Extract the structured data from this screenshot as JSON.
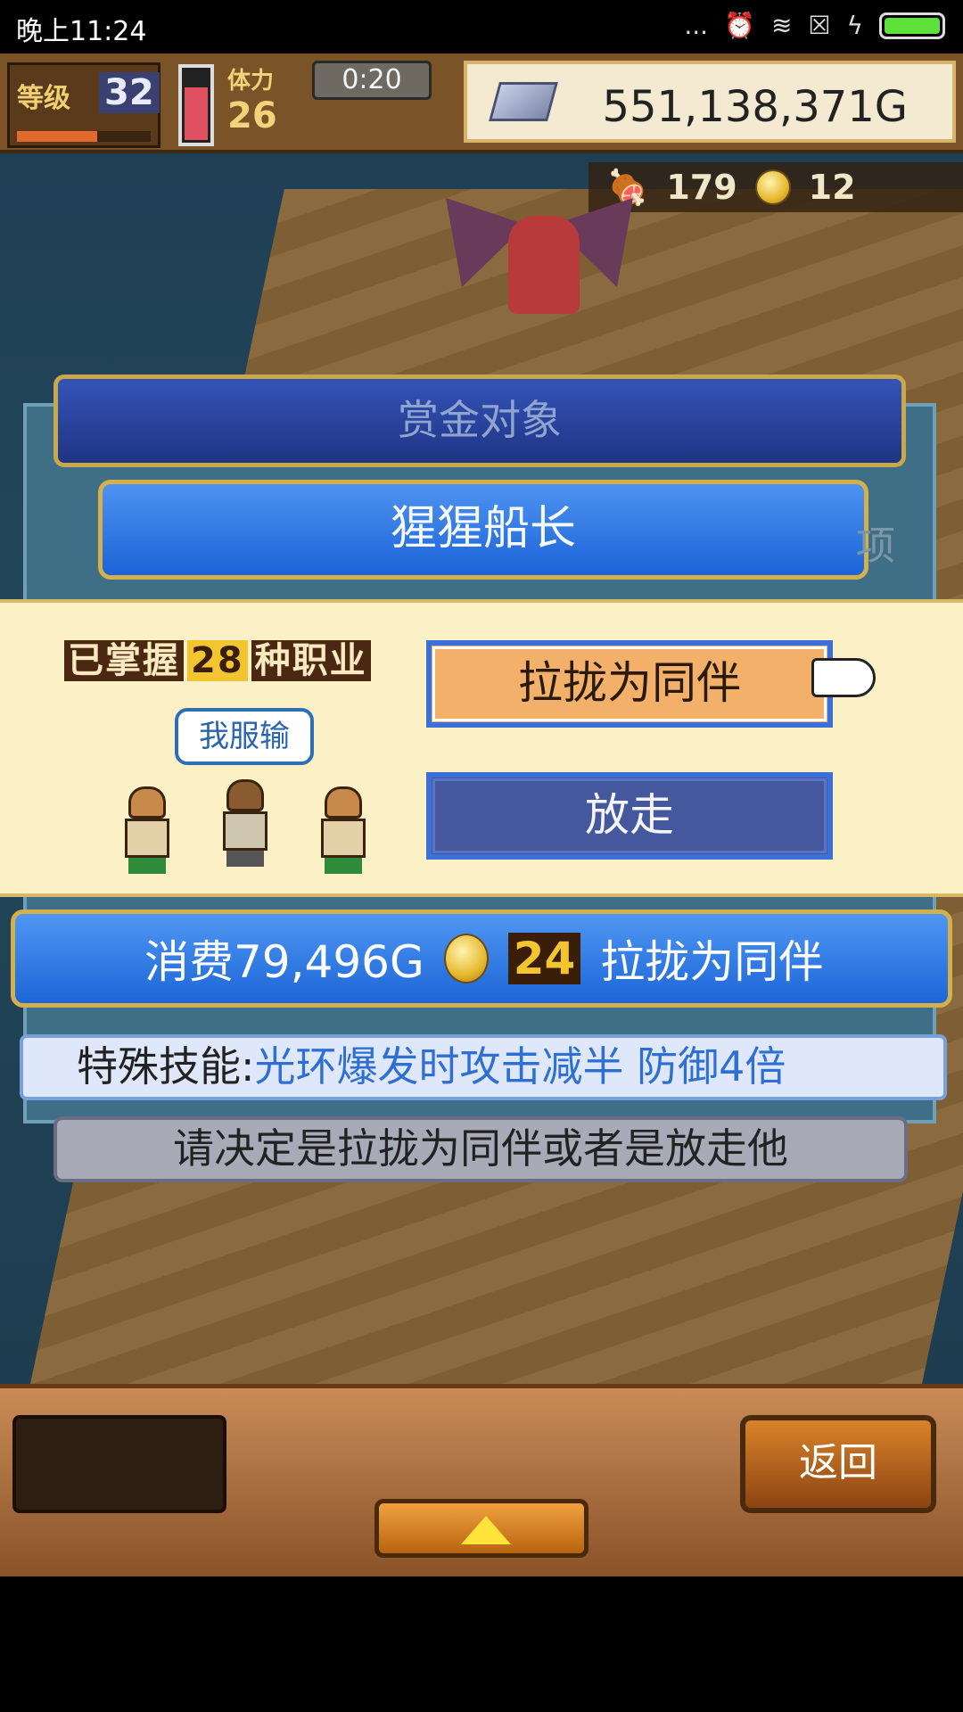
{
  "status_bar": {
    "time": "晚上11:24",
    "dots": "...",
    "alarm_icon": "alarm-icon",
    "wifi_icon": "wifi-icon",
    "sim_icon": "sim-icon",
    "charge_icon": "charge-icon"
  },
  "hud": {
    "level_label": "等级",
    "level": "32",
    "stamina_label": "体力",
    "stamina": "26",
    "timer": "0:20",
    "gold": "551,138,371G"
  },
  "counters": {
    "meat": "179",
    "coins": "12"
  },
  "bounty": {
    "title": "赏金对象",
    "target_name": "猩猩船长",
    "ghost": "项"
  },
  "choice": {
    "jobs_prefix": "已掌握",
    "jobs_count": "28",
    "jobs_suffix": "种职业",
    "speech": "我服输",
    "recruit_label": "拉拢为同伴",
    "release_label": "放走"
  },
  "cost": {
    "text": "消费79,496G",
    "coin_count": "24",
    "action": "拉拢为同伴"
  },
  "skill": {
    "label": "特殊技能:",
    "value": "光环爆发时攻击减半 防御4倍"
  },
  "notice": "请决定是拉拢为同伴或者是放走他",
  "bottom": {
    "back_label": "返回"
  },
  "colors": {
    "accent_blue": "#1c66d8",
    "gold": "#d4b04c"
  }
}
